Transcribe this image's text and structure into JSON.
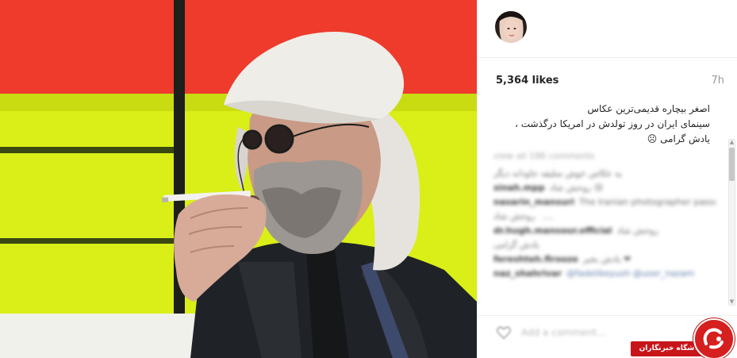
{
  "post": {
    "likes": "5,364 likes",
    "time": "7h",
    "caption_lines": [
      "اصغر بیچاره قدیمی‌ترین عکاس",
      "سینمای ایران در روز تولدش در امریکا درگذشت ،",
      "یادش گرامی ☹"
    ]
  },
  "comments": {
    "view_all": "view all 186 comments",
    "items": [
      {
        "user": "",
        "text": "یه عکاس خوش سلیقه جاودانه دیگر"
      },
      {
        "user": "sinah.mpp",
        "text": "روحش شاد 😢"
      },
      {
        "user": "nasarin_mansuri",
        "text": "The Iranian photographer passed away on his birthday 😢"
      },
      {
        "user": "",
        "text": "روحش شاد ...."
      },
      {
        "user": "dr.hugh.mansour.official",
        "text": "روحش شاد"
      },
      {
        "user": "",
        "text": "یادش گرامی"
      },
      {
        "user": "fereshteh.firooze",
        "text": "یادش بخیر ❤"
      },
      {
        "user": "naz_shahrivar",
        "text": "@fadelikeyush @user_nazam",
        "link": true
      }
    ]
  },
  "add_comment": {
    "placeholder": "Add a comment..."
  },
  "watermark": {
    "text": "باشگاه خبرنگاران"
  },
  "icons": {
    "heart": "heart-icon",
    "avatar": "avatar",
    "logo": "watermark-logo-icon"
  },
  "colors": {
    "red_panel": "#ee3b2c",
    "yellow_panel": "#d9ef17",
    "watermark_red": "#c8151a",
    "likes_text": "#262626",
    "time_text": "#999999"
  }
}
